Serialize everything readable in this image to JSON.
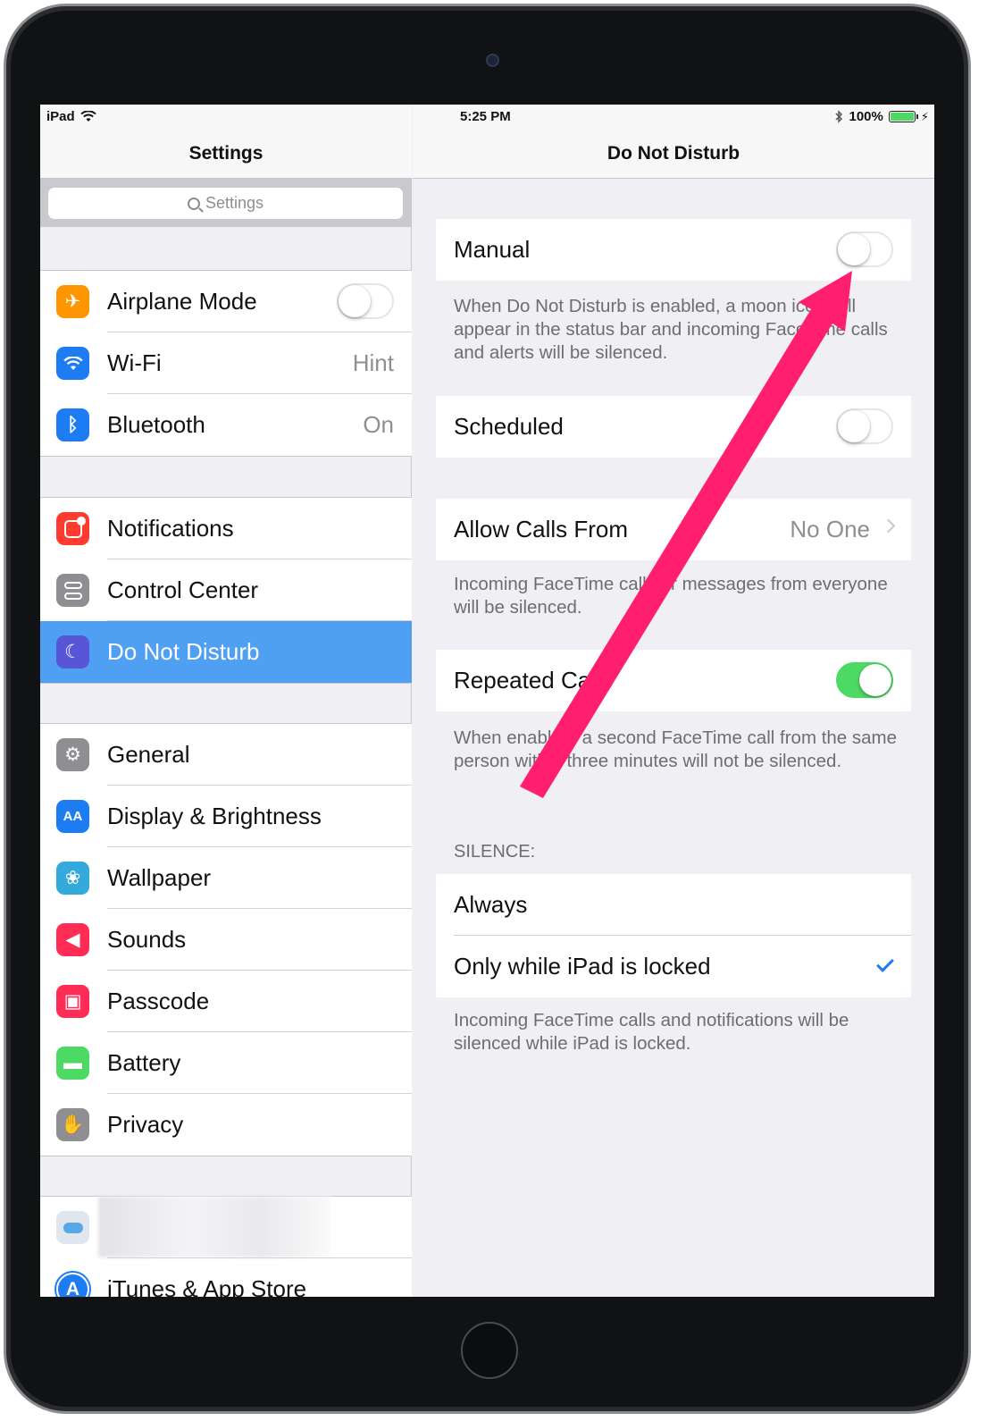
{
  "status_bar": {
    "device": "iPad",
    "time": "5:25 PM",
    "battery_label": "100%"
  },
  "master": {
    "title": "Settings",
    "search_placeholder": "Settings",
    "groups": [
      [
        {
          "label": "Airplane Mode",
          "icon": "airplane-icon",
          "icon_color": "#ff9500",
          "control": "toggle",
          "on": false
        },
        {
          "label": "Wi-Fi",
          "icon": "wifi-icon",
          "icon_color": "#1e7cf2",
          "value": "Hint"
        },
        {
          "label": "Bluetooth",
          "icon": "bluetooth-icon",
          "icon_color": "#1e7cf2",
          "value": "On"
        }
      ],
      [
        {
          "label": "Notifications",
          "icon": "notifications-icon",
          "icon_color": "#ff3b30"
        },
        {
          "label": "Control Center",
          "icon": "control-center-icon",
          "icon_color": "#8e8e93"
        },
        {
          "label": "Do Not Disturb",
          "icon": "moon-icon",
          "icon_color": "#5856d6",
          "selected": true
        }
      ],
      [
        {
          "label": "General",
          "icon": "gear-icon",
          "icon_color": "#8e8e93"
        },
        {
          "label": "Display & Brightness",
          "icon": "display-icon",
          "icon_color": "#1e7cf2"
        },
        {
          "label": "Wallpaper",
          "icon": "wallpaper-icon",
          "icon_color": "#34aadc"
        },
        {
          "label": "Sounds",
          "icon": "speaker-icon",
          "icon_color": "#ff2d55"
        },
        {
          "label": "Passcode",
          "icon": "lock-icon",
          "icon_color": "#ff2d55"
        },
        {
          "label": "Battery",
          "icon": "battery-icon",
          "icon_color": "#4cd964"
        },
        {
          "label": "Privacy",
          "icon": "hand-icon",
          "icon_color": "#8e8e93"
        }
      ],
      [
        {
          "label": "",
          "icon": "icloud-icon",
          "icon_color": "#dfe6ee",
          "blurred": true
        },
        {
          "label": "iTunes & App Store",
          "icon": "app-store-icon",
          "icon_color": "#1e7cf2"
        }
      ]
    ]
  },
  "detail": {
    "title": "Do Not Disturb",
    "manual": {
      "label": "Manual",
      "on": false,
      "footer": "When Do Not Disturb is enabled, a moon icon will appear in the status bar and incoming FaceTime calls and alerts will be silenced."
    },
    "scheduled": {
      "label": "Scheduled",
      "on": false
    },
    "allow_calls": {
      "label": "Allow Calls From",
      "value": "No One",
      "footer": "Incoming FaceTime calls or messages from everyone will be silenced."
    },
    "repeated_calls": {
      "label": "Repeated Calls",
      "on": true,
      "footer": "When enabled, a second FaceTime call from the same person within three minutes will not be silenced."
    },
    "silence": {
      "header": "SILENCE:",
      "options": [
        {
          "label": "Always",
          "checked": false
        },
        {
          "label": "Only while iPad is locked",
          "checked": true
        }
      ],
      "footer": "Incoming FaceTime calls and notifications will be silenced while iPad is locked."
    }
  },
  "annotation": {
    "color": "#ff1f6e"
  }
}
